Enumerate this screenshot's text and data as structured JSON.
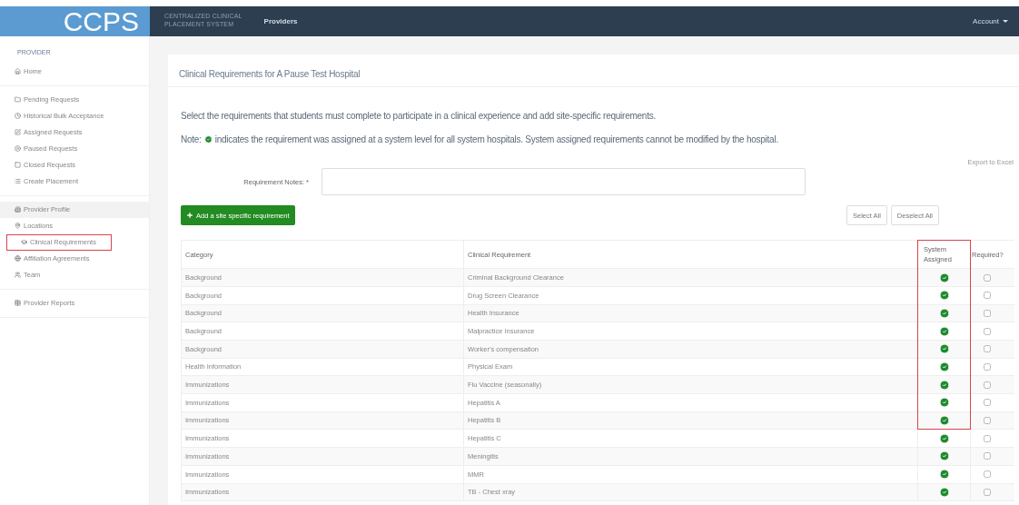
{
  "navbar": {
    "logo": "CCPS",
    "system_name": [
      "CENTRALIZED CLINICAL",
      "PLACEMENT SYSTEM"
    ],
    "nav_link": "Providers",
    "account_menu": "Account"
  },
  "sidebar": {
    "heading": "PROVIDER",
    "groups": [
      [
        {
          "label": "Home",
          "kind": "home",
          "selected": false,
          "highlighted": false
        }
      ],
      [
        {
          "label": "Pending Requests",
          "kind": "folder",
          "selected": false,
          "highlighted": false
        },
        {
          "label": "Historical Bulk Acceptance",
          "kind": "clock",
          "selected": false,
          "highlighted": false
        },
        {
          "label": "Assigned Requests",
          "kind": "edit",
          "selected": false,
          "highlighted": false
        },
        {
          "label": "Paused Requests",
          "kind": "pause",
          "selected": false,
          "highlighted": false
        },
        {
          "label": "Closed Requests",
          "kind": "square",
          "selected": false,
          "highlighted": false
        },
        {
          "label": "Create Placement",
          "kind": "list",
          "selected": false,
          "highlighted": false
        }
      ],
      [
        {
          "label": "Provider Profile",
          "kind": "building",
          "selected": true,
          "highlighted": false
        },
        {
          "label": "Locations",
          "kind": "pin",
          "selected": false,
          "highlighted": false
        },
        {
          "label": "Clinical Requirements",
          "kind": "cap",
          "selected": false,
          "highlighted": true
        },
        {
          "label": "Affiliation Agreements",
          "kind": "globe",
          "selected": false,
          "highlighted": false
        },
        {
          "label": "Team",
          "kind": "users",
          "selected": false,
          "highlighted": false
        }
      ],
      [
        {
          "label": "Provider Reports",
          "kind": "table",
          "selected": false,
          "highlighted": false
        }
      ]
    ]
  },
  "page": {
    "title": "Clinical Requirements for A Pause Test Hospital",
    "instructions": "Select the requirements that students must complete to participate in a clinical experience and add site-specific requirements.",
    "note_label": "Note:",
    "note_text": "indicates the requirement was assigned at a system level for all system hospitals. System assigned requirements cannot be modified by the hospital.",
    "export_link": "Export to Excel",
    "notes_field_label": "Requirement Notes: *",
    "add_button": "Add a site specific requirement",
    "select_all_button": "Select All",
    "deselect_all_button": "Deselect All"
  },
  "table": {
    "columns": [
      "Category",
      "Clinical Requirement",
      "System Assigned",
      "Required?"
    ],
    "header_highlighted": true,
    "rows": [
      {
        "category": "Background",
        "requirement": "Criminal Background Clearance",
        "system_assigned": true,
        "required": false,
        "highlighted": true
      },
      {
        "category": "Background",
        "requirement": "Drug Screen Clearance",
        "system_assigned": true,
        "required": false,
        "highlighted": true
      },
      {
        "category": "Background",
        "requirement": "Health Insurance",
        "system_assigned": true,
        "required": false,
        "highlighted": true
      },
      {
        "category": "Background",
        "requirement": "Malpractice Insurance",
        "system_assigned": true,
        "required": false,
        "highlighted": true
      },
      {
        "category": "Background",
        "requirement": "Worker's compensation",
        "system_assigned": true,
        "required": false,
        "highlighted": true
      },
      {
        "category": "Health Information",
        "requirement": "Physical Exam",
        "system_assigned": true,
        "required": false,
        "highlighted": true
      },
      {
        "category": "Immunizations",
        "requirement": "Flu Vaccine (seasonally)",
        "system_assigned": true,
        "required": false,
        "highlighted": true
      },
      {
        "category": "Immunizations",
        "requirement": "Hepatitis A",
        "system_assigned": true,
        "required": false,
        "highlighted": true
      },
      {
        "category": "Immunizations",
        "requirement": "Hepatitis B",
        "system_assigned": true,
        "required": false,
        "highlighted": true
      },
      {
        "category": "Immunizations",
        "requirement": "Hepatitis C",
        "system_assigned": true,
        "required": false,
        "highlighted": false
      },
      {
        "category": "Immunizations",
        "requirement": "Meningitis",
        "system_assigned": true,
        "required": false,
        "highlighted": false
      },
      {
        "category": "Immunizations",
        "requirement": "MMR",
        "system_assigned": true,
        "required": false,
        "highlighted": false
      },
      {
        "category": "Immunizations",
        "requirement": "TB - Chest xray",
        "system_assigned": true,
        "required": false,
        "highlighted": false
      }
    ]
  }
}
